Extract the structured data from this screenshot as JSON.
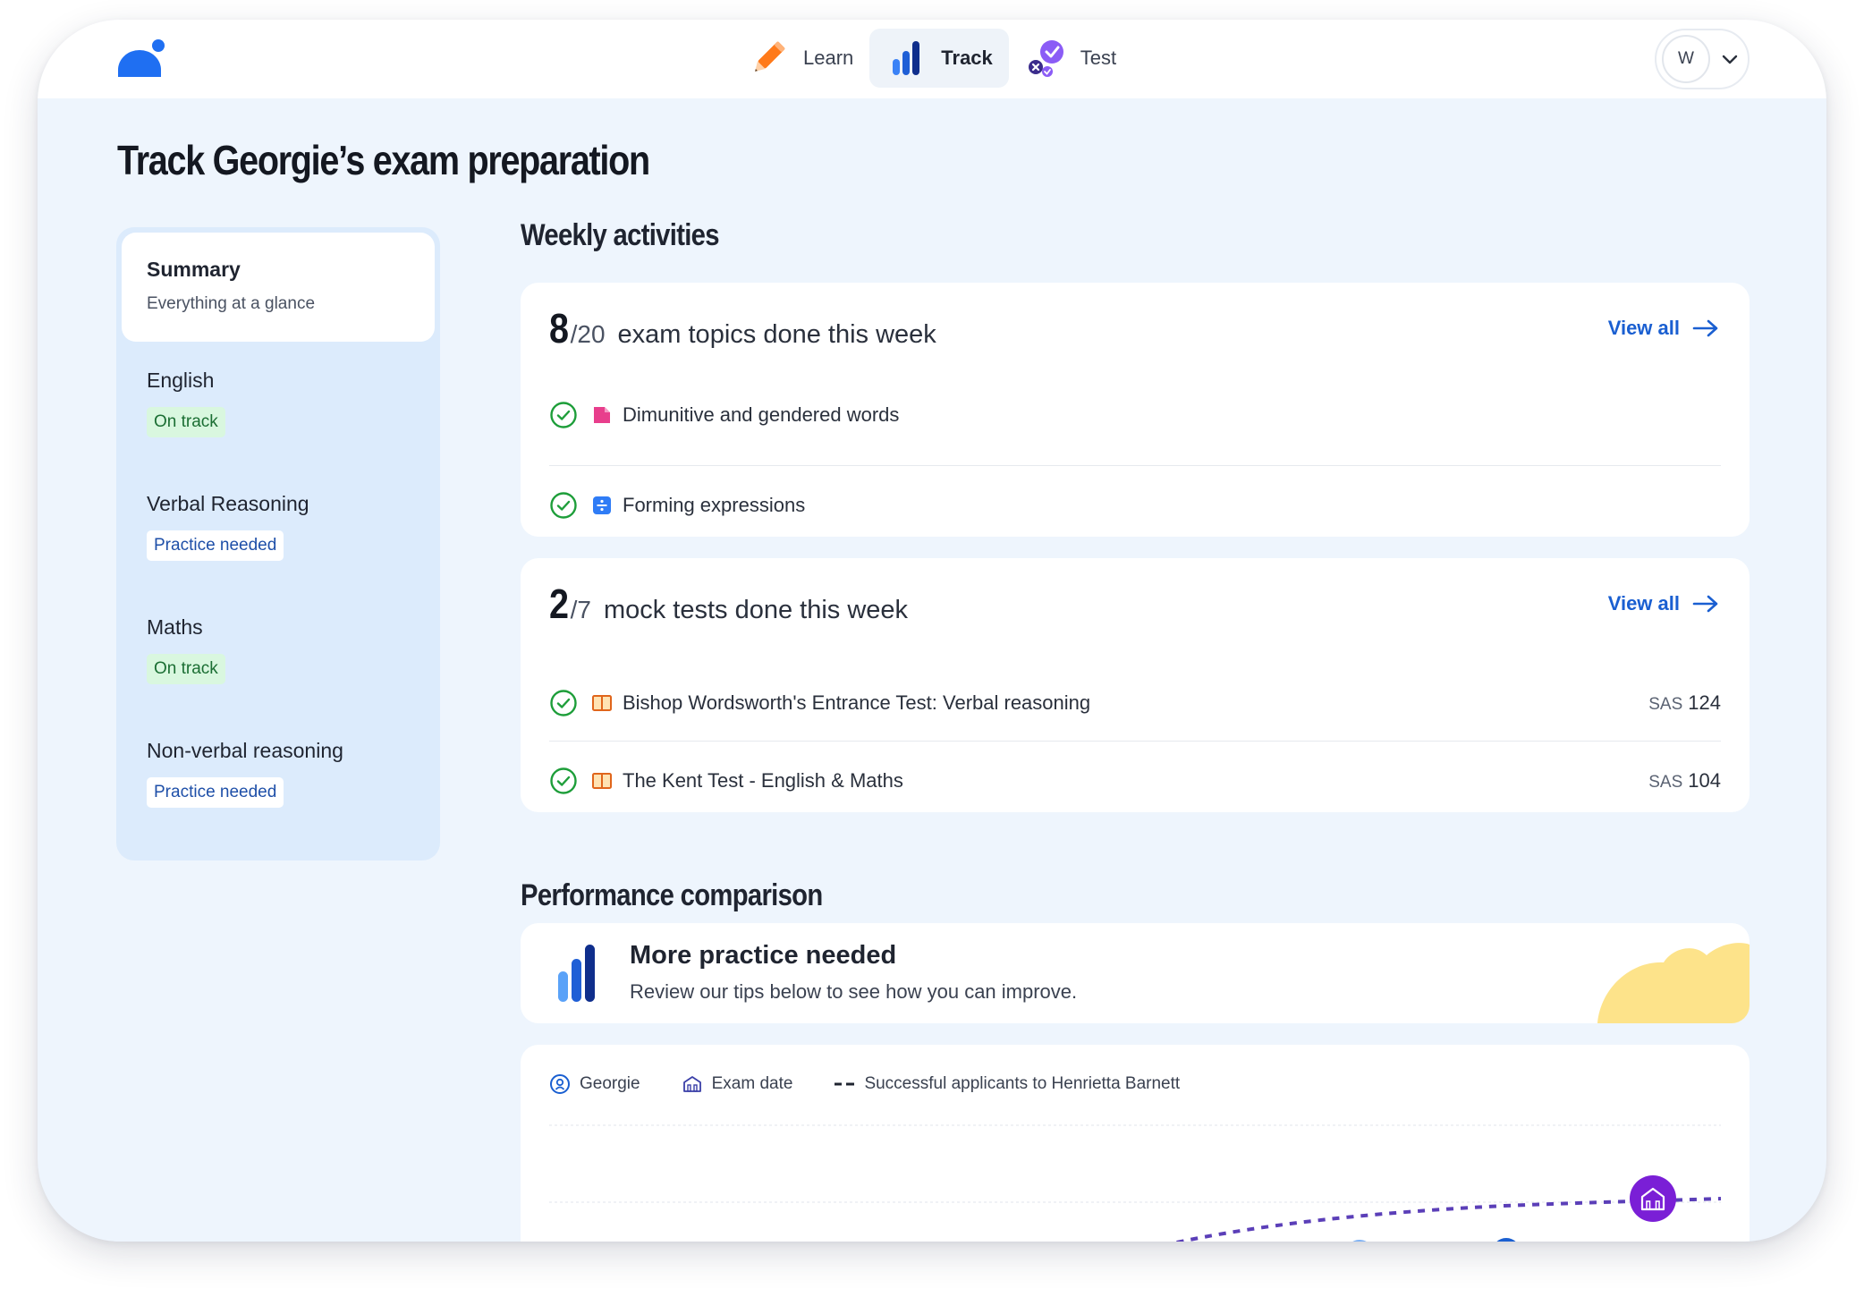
{
  "nav": {
    "items": [
      {
        "label": "Learn",
        "icon": "pencil-icon"
      },
      {
        "label": "Track",
        "icon": "bar-chart-icon",
        "active": true
      },
      {
        "label": "Test",
        "icon": "test-check-icon"
      }
    ]
  },
  "user": {
    "initial": "W"
  },
  "page": {
    "title": "Track Georgie’s exam preparation"
  },
  "sidebar": {
    "items": [
      {
        "title": "Summary",
        "subtitle": "Everything at a glance"
      },
      {
        "title": "English",
        "badge": "On track"
      },
      {
        "title": "Verbal Reasoning",
        "badge": "Practice needed"
      },
      {
        "title": "Maths",
        "badge": "On track"
      },
      {
        "title": "Non-verbal reasoning",
        "badge": "Practice needed"
      }
    ]
  },
  "weekly": {
    "heading": "Weekly activities",
    "topics": {
      "done": "8",
      "total": "/20",
      "title": "exam topics done this week",
      "view_all": "View all",
      "rows": [
        {
          "text": "Dimunitive and gendered words"
        },
        {
          "text": "Forming expressions"
        }
      ]
    },
    "tests": {
      "done": "2",
      "total": "/7",
      "title": "mock tests done this week",
      "view_all": "View all",
      "rows": [
        {
          "text": "Bishop Wordsworth's Entrance Test: Verbal reasoning",
          "sas_label": "SAS",
          "sas": "124"
        },
        {
          "text": "The Kent Test - English & Maths",
          "sas_label": "SAS",
          "sas": "104"
        }
      ]
    }
  },
  "performance": {
    "heading": "Performance comparison",
    "banner_title": "More practice needed",
    "banner_sub": "Review our tips below to see how you can improve.",
    "legend": [
      {
        "label": "Georgie",
        "icon": "person-marker-icon"
      },
      {
        "label": "Exam date",
        "icon": "school-icon"
      },
      {
        "label": "Successful applicants to Henrietta Barnett",
        "icon": "dashed-line-icon"
      }
    ]
  },
  "colors": {
    "brand_blue": "#1a5fd1",
    "sidebar_bg": "#dcebfc",
    "page_bg": "#eef5fd",
    "success_green": "#1e9e3a",
    "dashed_purple": "#5b3fb8",
    "exam_purple": "#7a1fd6",
    "banner_blob": "#fde38a"
  }
}
